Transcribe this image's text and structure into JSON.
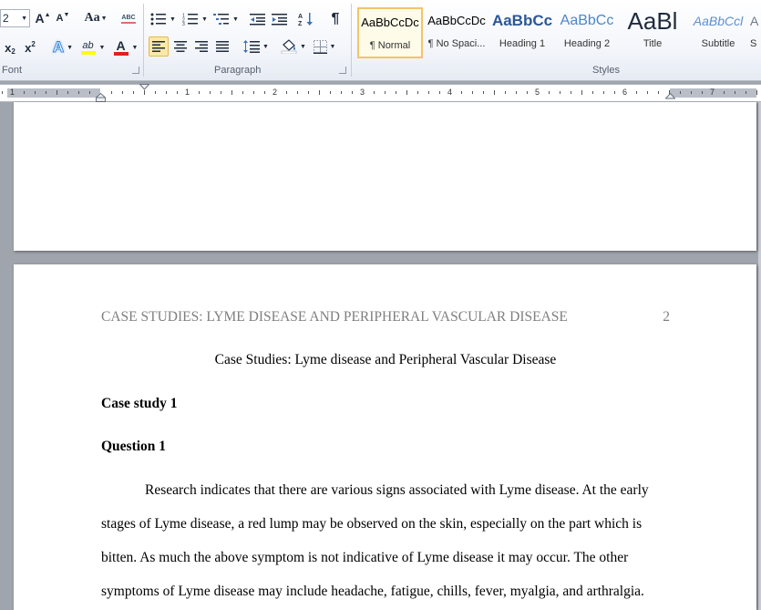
{
  "ribbon": {
    "font": {
      "size_value": "2",
      "grow_label": "A",
      "shrink_label": "A",
      "change_case_label": "Aa",
      "clear_format_label": "ABC",
      "subscript_label": "x",
      "subscript_small": "2",
      "superscript_label": "x",
      "superscript_small": "2",
      "text_effects_label": "A",
      "highlight_label": "ab",
      "font_color_label": "A",
      "group_label": "Font"
    },
    "paragraph": {
      "group_label": "Paragraph",
      "show_marks_label": "¶"
    },
    "styles": {
      "group_label": "Styles",
      "items": [
        {
          "preview": "AaBbCcDc",
          "name": "¶ Normal"
        },
        {
          "preview": "AaBbCcDc",
          "name": "¶ No Spaci..."
        },
        {
          "preview": "AaBbCc",
          "name": "Heading 1"
        },
        {
          "preview": "AaBbCc",
          "name": "Heading 2"
        },
        {
          "preview": "AaBl",
          "name": "Title"
        },
        {
          "preview": "AaBbCcl",
          "name": "Subtitle"
        },
        {
          "preview": "A",
          "name": "S"
        }
      ]
    }
  },
  "ruler": {
    "numbers": [
      "1",
      "1",
      "2",
      "3",
      "4",
      "5",
      "6",
      "7"
    ]
  },
  "document": {
    "header_text": "CASE STUDIES: LYME DISEASE AND PERIPHERAL VASCULAR DISEASE",
    "page_number": "2",
    "title": "Case Studies: Lyme disease and Peripheral Vascular Disease",
    "case_study_heading": "Case study 1",
    "question_heading": "Question 1",
    "paragraph_lines": [
      "Research indicates that there are various signs associated with Lyme disease. At the early",
      "stages of Lyme disease, a red lump may be observed on the skin, especially on the part which is",
      "bitten. As much the above symptom is not indicative of Lyme disease it may occur. The other",
      "symptoms of Lyme disease may include headache, fatigue, chills, fever, myalgia, and arthralgia."
    ]
  }
}
